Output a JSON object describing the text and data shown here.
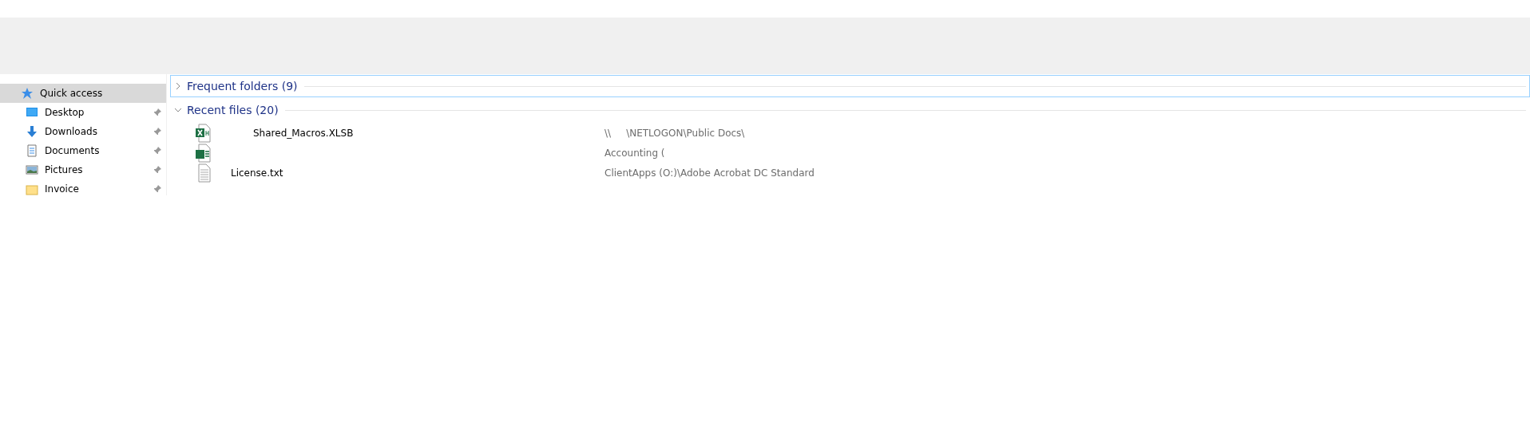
{
  "sidebar": {
    "items": [
      {
        "label": "Quick access",
        "kind": "star",
        "selected": true,
        "pinned": false
      },
      {
        "label": "Desktop",
        "kind": "desktop",
        "selected": false,
        "pinned": true
      },
      {
        "label": "Downloads",
        "kind": "downloads",
        "selected": false,
        "pinned": true
      },
      {
        "label": "Documents",
        "kind": "documents",
        "selected": false,
        "pinned": true
      },
      {
        "label": "Pictures",
        "kind": "pictures",
        "selected": false,
        "pinned": true
      },
      {
        "label": "Invoice",
        "kind": "folder",
        "selected": false,
        "pinned": true
      }
    ]
  },
  "groups": [
    {
      "title": "Frequent folders (9)",
      "expanded": false,
      "focused": true
    },
    {
      "title": "Recent files (20)",
      "expanded": true,
      "focused": false
    }
  ],
  "recent_files": [
    {
      "name": "Shared_Macros.XLSB",
      "kind": "xlsb",
      "path": "\\\\     \\NETLOGON\\Public Docs\\",
      "indent": true
    },
    {
      "kind": "xlsx",
      "path": "Accounting (",
      "indent": false
    },
    {
      "name": "License.txt",
      "kind": "txt",
      "path": "ClientApps (O:)\\Adobe Acrobat DC Standard",
      "indent": false
    }
  ]
}
